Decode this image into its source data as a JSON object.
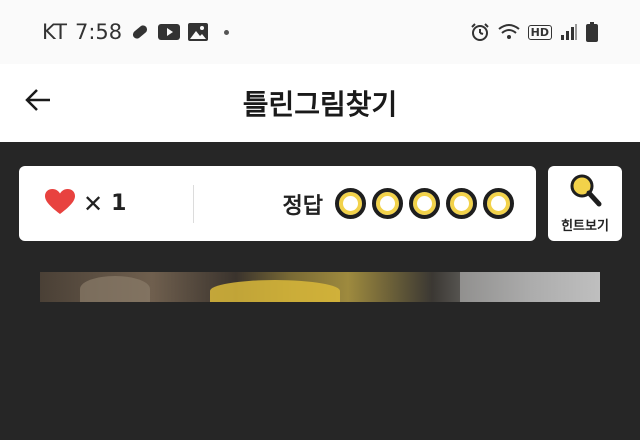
{
  "status_bar": {
    "carrier": "KT",
    "time": "7:58",
    "icons_left": [
      "pill-icon",
      "youtube-icon",
      "image-icon"
    ],
    "icons_right": [
      "alarm-icon",
      "wifi-icon",
      "hd-icon",
      "signal-icon",
      "battery-icon"
    ],
    "hd_label": "HD"
  },
  "app_bar": {
    "title": "틀린그림찾기",
    "back_icon": "arrow-left-icon"
  },
  "score_card": {
    "lives_icon": "heart-icon",
    "lives_multiplier": "✕",
    "lives_count": "1",
    "answers_label": "정답",
    "answers_total": 5,
    "answers_found": 0
  },
  "hint_button": {
    "label": "힌트보기",
    "icon": "magnifier-icon"
  },
  "colors": {
    "heart": "#e8423f",
    "accent_yellow": "#f2d24a",
    "content_bg": "#262626"
  }
}
